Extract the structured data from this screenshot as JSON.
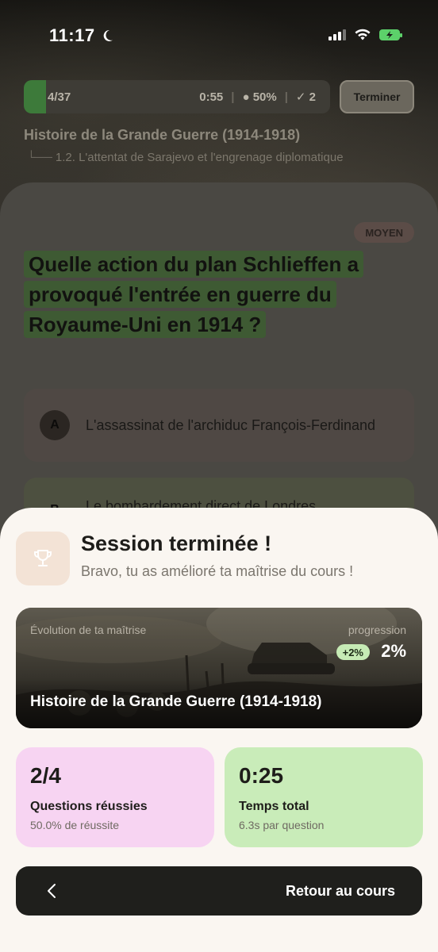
{
  "status_bar": {
    "time": "11:17"
  },
  "quiz": {
    "progress_count": "4/37",
    "progress_fraction": 0.05,
    "timer": "0:55",
    "success_rate": "● 50%",
    "correct": "✓ 2",
    "finish_label": "Terminer",
    "course_title": "Histoire de la Grande Guerre (1914-1918)",
    "chapter_title": "1.2. L'attentat de Sarajevo et l'engrenage diplomatique",
    "chapter_prefix": "└──",
    "difficulty": "MOYEN",
    "question": "Quelle action du plan Schlieffen a provoqué l'entrée en guerre du Royaume-Uni en 1914 ?",
    "answers": [
      {
        "letter": "A",
        "text": "L'assassinat de l'archiduc François-Ferdinand"
      },
      {
        "letter": "B",
        "text": "Le bombardement direct de Londres"
      }
    ]
  },
  "sheet": {
    "icon": "trophy-icon",
    "title": "Session terminée !",
    "subtitle": "Bravo, tu as amélioré ta maîtrise du cours !",
    "mastery": {
      "label": "Évolution de ta maîtrise",
      "progress_label": "progression",
      "delta": "+2%",
      "value": "2%",
      "course": "Histoire de la Grande Guerre (1914-1918)"
    },
    "stats": {
      "score_value": "2/4",
      "score_label": "Questions réussies",
      "score_sub": "50.0% de réussite",
      "time_value": "0:25",
      "time_label": "Temps total",
      "time_sub": "6.3s par question"
    },
    "back_label": "Retour au cours"
  },
  "colors": {
    "sheet_bg": "#faf6f1",
    "score_card": "#f7d4f2",
    "time_card": "#c9ecb9",
    "button_bg": "#1f1f1c",
    "delta_badge": "#c6ebb5"
  }
}
